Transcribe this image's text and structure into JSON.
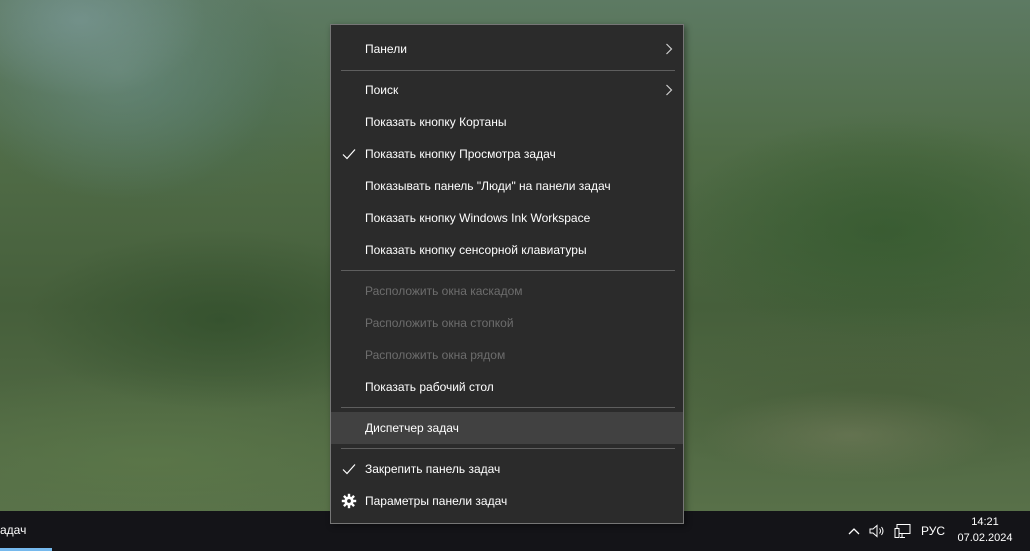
{
  "taskbar": {
    "left_label": "адач",
    "language": "РУС",
    "time": "14:21",
    "date": "07.02.2024"
  },
  "menu": {
    "items": [
      {
        "label": "Панели",
        "submenu": true,
        "checked": false,
        "enabled": true
      },
      {
        "label": "Поиск",
        "submenu": true,
        "checked": false,
        "enabled": true
      },
      {
        "label": "Показать кнопку Кортаны",
        "checked": false,
        "enabled": true
      },
      {
        "label": "Показать кнопку Просмотра задач",
        "checked": true,
        "enabled": true
      },
      {
        "label": "Показывать панель \"Люди\" на панели задач",
        "checked": false,
        "enabled": true
      },
      {
        "label": "Показать кнопку Windows Ink Workspace",
        "checked": false,
        "enabled": true
      },
      {
        "label": "Показать кнопку сенсорной клавиатуры",
        "checked": false,
        "enabled": true
      },
      {
        "label": "Расположить окна каскадом",
        "checked": false,
        "enabled": false
      },
      {
        "label": "Расположить окна стопкой",
        "checked": false,
        "enabled": false
      },
      {
        "label": "Расположить окна рядом",
        "checked": false,
        "enabled": false
      },
      {
        "label": "Показать рабочий стол",
        "checked": false,
        "enabled": true
      },
      {
        "label": "Диспетчер задач",
        "checked": false,
        "enabled": true,
        "highlighted": true
      },
      {
        "label": "Закрепить панель задач",
        "checked": true,
        "enabled": true
      },
      {
        "label": "Параметры панели задач",
        "icon": "gear-icon",
        "checked": false,
        "enabled": true
      }
    ]
  },
  "colors": {
    "menu_bg": "#2b2b2b",
    "menu_border": "#767676",
    "menu_hover": "#414141",
    "menu_text": "#ffffff",
    "menu_disabled_text": "#6d6d6d",
    "taskbar_bg": "#141418",
    "accent": "#76b9ed"
  }
}
